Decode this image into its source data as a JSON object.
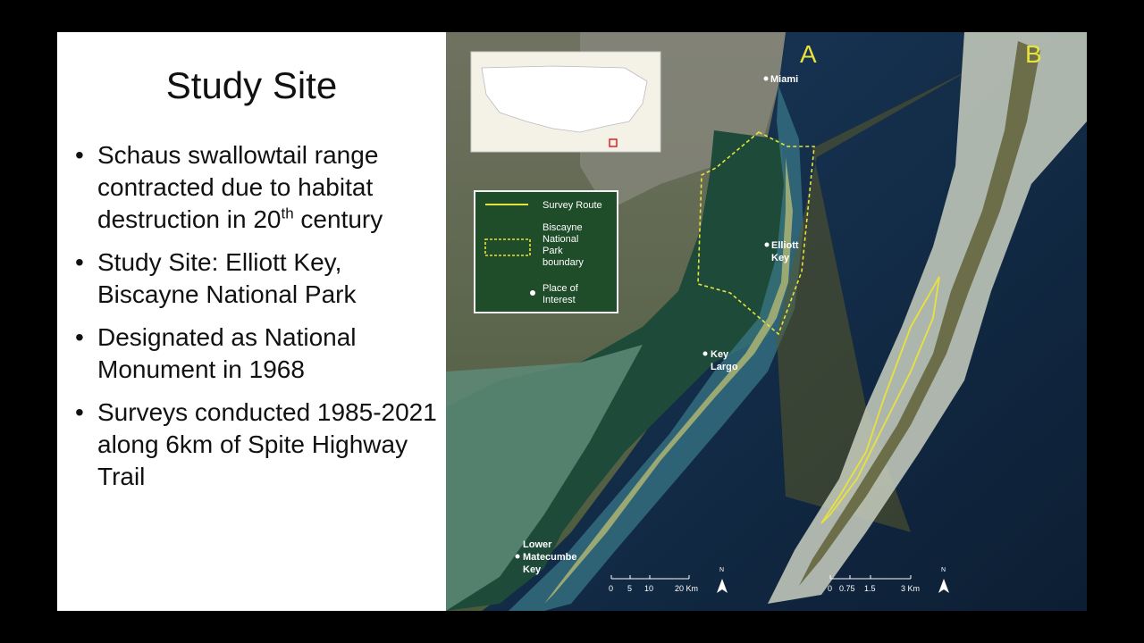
{
  "slide": {
    "title": "Study Site",
    "bullets": [
      {
        "text": "Schaus swallowtail range contracted due to habitat destruction in 20",
        "sup": "th",
        "after": " century"
      },
      {
        "text": "Study Site: Elliott Key, Biscayne National Park"
      },
      {
        "text": "Designated as National Monument in 1968"
      },
      {
        "text": "Surveys conducted 1985-2021 along 6km of Spite Highway Trail"
      }
    ]
  },
  "map": {
    "panel_a": "A",
    "panel_b": "B",
    "places": [
      "Miami",
      "Elliott",
      "Key",
      "Key",
      "Largo",
      "Lower",
      "Matecumbe",
      "Key"
    ],
    "legend": {
      "survey_route": "Survey Route",
      "boundary": [
        "Biscayne",
        "National",
        "Park",
        "boundary"
      ],
      "place": [
        "Place of",
        "Interest"
      ]
    },
    "scale_a": {
      "ticks": [
        "0",
        "5",
        "10",
        "20 Km"
      ]
    },
    "scale_b": {
      "ticks": [
        "0",
        "0.75",
        "1.5",
        "3 Km"
      ]
    },
    "north": "N",
    "colors": {
      "route": "#e8e23c",
      "legend_bg": "#1f4d2a",
      "ocean": "#0f2742"
    }
  }
}
